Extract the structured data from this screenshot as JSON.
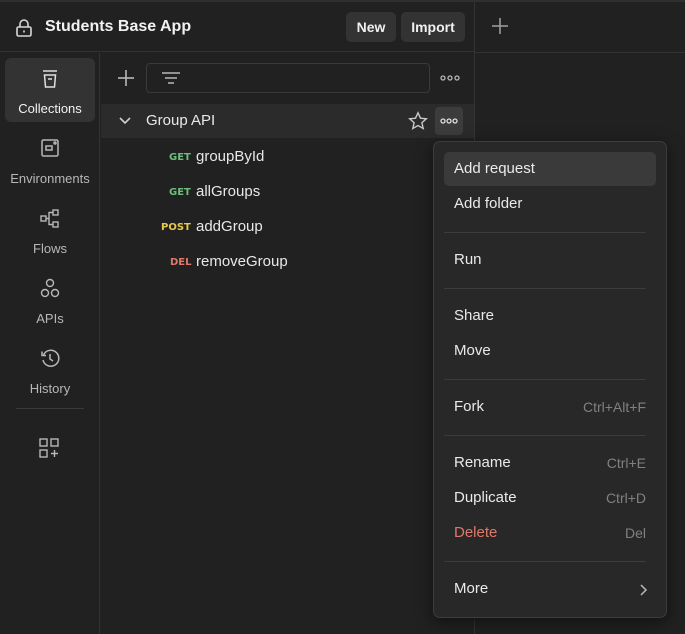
{
  "header": {
    "title": "Students Base App",
    "new_label": "New",
    "import_label": "Import"
  },
  "nav": [
    {
      "label": "Collections",
      "icon": "collections-icon",
      "active": true
    },
    {
      "label": "Environments",
      "icon": "environments-icon"
    },
    {
      "label": "Flows",
      "icon": "flows-icon"
    },
    {
      "label": "APIs",
      "icon": "apis-icon"
    },
    {
      "label": "History",
      "icon": "history-icon"
    }
  ],
  "filter": {
    "placeholder": "",
    "value": ""
  },
  "collection": {
    "name": "Group API",
    "requests": [
      {
        "method": "GET",
        "name": "groupById",
        "color": "#6bbf7a"
      },
      {
        "method": "GET",
        "name": "allGroups",
        "color": "#6bbf7a"
      },
      {
        "method": "POST",
        "name": "addGroup",
        "color": "#e6c94e"
      },
      {
        "method": "DEL",
        "name": "removeGroup",
        "color": "#e0786a"
      }
    ]
  },
  "menu": {
    "items": [
      {
        "label": "Add request",
        "shortcut": ""
      },
      {
        "label": "Add folder",
        "shortcut": ""
      },
      {
        "label": "Run",
        "shortcut": ""
      },
      {
        "label": "Share",
        "shortcut": ""
      },
      {
        "label": "Move",
        "shortcut": ""
      },
      {
        "label": "Fork",
        "shortcut": "Ctrl+Alt+F"
      },
      {
        "label": "Rename",
        "shortcut": "Ctrl+E"
      },
      {
        "label": "Duplicate",
        "shortcut": "Ctrl+D"
      },
      {
        "label": "Delete",
        "shortcut": "Del"
      },
      {
        "label": "More",
        "shortcut": ""
      }
    ]
  },
  "colors": {
    "background": "#212121",
    "get": "#6bbf7a",
    "post": "#e6c94e",
    "delete": "#e0786a",
    "highlight": "#3a3a3a"
  }
}
